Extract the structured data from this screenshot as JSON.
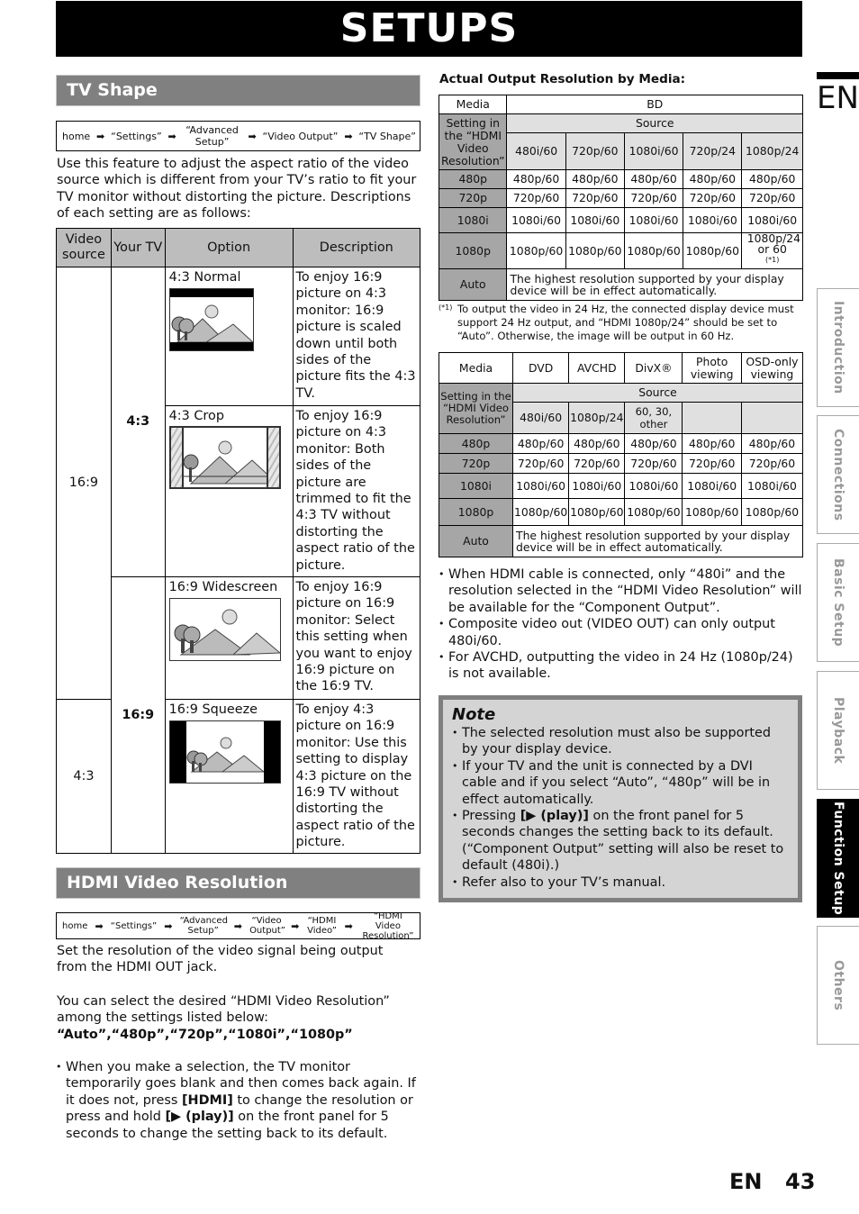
{
  "page": {
    "title": "SETUPS",
    "lang_badge": "EN",
    "footer_lang": "EN",
    "page_number": "43"
  },
  "tv_shape": {
    "heading": "TV Shape",
    "breadcrumb": [
      "home",
      "“Settings”",
      "“Advanced Setup”",
      "“Video Output”",
      "“TV Shape”"
    ],
    "intro": "Use this feature to adjust the aspect ratio of the video source which is different from your TV’s ratio to fit your TV monitor without distorting the picture. Descriptions of each setting are as follows:",
    "table": {
      "headers": [
        "Video source",
        "Your TV",
        "Option",
        "Description"
      ],
      "source_16_9": "16:9",
      "source_4_3": "4:3",
      "tv_4_3": "4:3",
      "tv_16_9": "16:9",
      "rows": [
        {
          "option": "4:3 Normal",
          "icon": "letterbox-picture-icon",
          "description": "To enjoy 16:9 picture on 4:3 monitor: 16:9 picture is scaled down until both sides of the picture fits the 4:3 TV."
        },
        {
          "option": "4:3 Crop",
          "icon": "cropped-picture-icon",
          "description": "To enjoy 16:9 picture on 4:3 monitor: Both sides of the picture are trimmed to fit the 4:3 TV without distorting the aspect ratio of the picture."
        },
        {
          "option": "16:9 Widescreen",
          "icon": "widescreen-picture-icon",
          "description": "To enjoy 16:9 picture on 16:9 monitor: Select this setting when you want to enjoy 16:9 picture on the 16:9 TV."
        },
        {
          "option": "16:9 Squeeze",
          "icon": "pillarbox-picture-icon",
          "description": "To enjoy 4:3 picture on 16:9 monitor: Use this setting to display 4:3 picture on the 16:9 TV without distorting the aspect ratio of the picture."
        }
      ]
    }
  },
  "hdmi": {
    "heading": "HDMI Video Resolution",
    "breadcrumb": [
      "home",
      "“Settings”",
      "“Advanced Setup”",
      "“Video Output”",
      "“HDMI Video”",
      "“HDMI Video Resolution”"
    ],
    "para1": "Set the resolution of the video signal being output from the HDMI OUT jack.",
    "para2": "You can select the desired “HDMI Video Resolution” among the settings listed below:",
    "options_line": "“Auto”,“480p”,“720p”,“1080i”,“1080p”",
    "bullet": {
      "t1": "When you make a selection, the TV monitor temporarily goes blank and then comes back again. If it does not, press ",
      "b1": "[HDMI]",
      "t2": " to change the resolution or press and hold ",
      "b2": "[▶ (play)]",
      "t3": " on the front panel for 5 seconds to change the setting back to its default."
    }
  },
  "output_table_title": "Actual Output Resolution by Media:",
  "bd_table": {
    "media_label": "Media",
    "media": "BD",
    "setting_label": "Setting in the “HDMI Video Resolution”",
    "source_label": "Source",
    "sources": [
      "480i/60",
      "720p/60",
      "1080i/60",
      "720p/24",
      "1080p/24"
    ],
    "rows": [
      {
        "setting": "480p",
        "values": [
          "480p/60",
          "480p/60",
          "480p/60",
          "480p/60",
          "480p/60"
        ]
      },
      {
        "setting": "720p",
        "values": [
          "720p/60",
          "720p/60",
          "720p/60",
          "720p/60",
          "720p/60"
        ]
      },
      {
        "setting": "1080i",
        "values": [
          "1080i/60",
          "1080i/60",
          "1080i/60",
          "1080i/60",
          "1080i/60"
        ]
      },
      {
        "setting": "1080p",
        "values": [
          "1080p/60",
          "1080p/60",
          "1080p/60",
          "1080p/60",
          "1080p/24 or 60"
        ],
        "footnote_ref": "(*1)"
      }
    ],
    "auto_setting": "Auto",
    "auto_text": "The highest resolution supported by your display device will be in effect automatically."
  },
  "footnote": {
    "mark": "(*1)",
    "text": "To output the video in 24 Hz, the connected display device must support 24 Hz output, and “HDMI 1080p/24” should be set to “Auto”. Otherwise, the image will be output in 60 Hz."
  },
  "media_table": {
    "media_label": "Media",
    "media": [
      "DVD",
      "AVCHD",
      "DivX®",
      "Photo viewing",
      "OSD-only viewing"
    ],
    "setting_label": "Setting in the “HDMI Video Resolution”",
    "source_label": "Source",
    "sources": [
      "480i/60",
      "1080p/24",
      "60, 30, other",
      "",
      ""
    ],
    "rows": [
      {
        "setting": "480p",
        "values": [
          "480p/60",
          "480p/60",
          "480p/60",
          "480p/60",
          "480p/60"
        ]
      },
      {
        "setting": "720p",
        "values": [
          "720p/60",
          "720p/60",
          "720p/60",
          "720p/60",
          "720p/60"
        ]
      },
      {
        "setting": "1080i",
        "values": [
          "1080i/60",
          "1080i/60",
          "1080i/60",
          "1080i/60",
          "1080i/60"
        ]
      },
      {
        "setting": "1080p",
        "values": [
          "1080p/60",
          "1080p/60",
          "1080p/60",
          "1080p/60",
          "1080p/60"
        ]
      }
    ],
    "auto_setting": "Auto",
    "auto_text": "The highest resolution supported by your display device will be in effect automatically."
  },
  "right_bullets": [
    "When HDMI cable is connected, only “480i” and the resolution selected in the “HDMI Video Resolution” will be available for the “Component Output”.",
    "Composite video out (VIDEO OUT) can only output 480i/60.",
    "For AVCHD, outputting the video in 24 Hz (1080p/24) is not available."
  ],
  "note": {
    "title": "Note",
    "items": [
      {
        "text": "The selected resolution must also be supported by your display device."
      },
      {
        "text": "If your TV and the unit is connected by a DVI cable and if you select “Auto”, “480p” will be in effect automatically."
      },
      {
        "pre": "Pressing ",
        "bold": "[▶ (play)]",
        "post": " on the front panel for 5 seconds changes the setting back to its default. (“Component Output” setting will also be reset to default (480i).)"
      },
      {
        "text": "Refer also to your TV’s manual."
      }
    ]
  },
  "side_tabs": [
    {
      "label": "Introduction",
      "active": false
    },
    {
      "label": "Connections",
      "active": false
    },
    {
      "label": "Basic Setup",
      "active": false
    },
    {
      "label": "Playback",
      "active": false
    },
    {
      "label": "Function Setup",
      "active": true
    },
    {
      "label": "Others",
      "active": false
    }
  ]
}
